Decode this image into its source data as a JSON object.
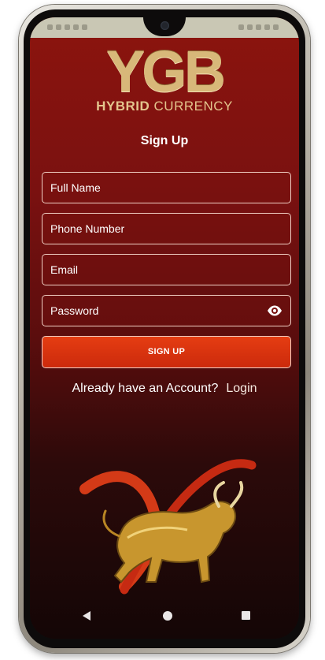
{
  "logo": {
    "mark": "YGB",
    "sub_bold": "HYBRID",
    "sub_rest": " CURRENCY"
  },
  "signup": {
    "title": "Sign Up",
    "fields": {
      "full_name": "Full Name",
      "phone": "Phone Number",
      "email": "Email",
      "password": "Password"
    },
    "button_label": "SIGN UP",
    "login_prompt": "Already have an Account?",
    "login_link": "Login"
  },
  "icons": {
    "password_toggle": "eye-icon",
    "nav_back": "triangle-left-icon",
    "nav_home": "circle-icon",
    "nav_recent": "square-icon"
  },
  "colors": {
    "background_top": "#8c140e",
    "background_bottom": "#140606",
    "logo_gold": "#d8b879",
    "button": "#d9320e",
    "field_border": "#f0cfc4"
  }
}
